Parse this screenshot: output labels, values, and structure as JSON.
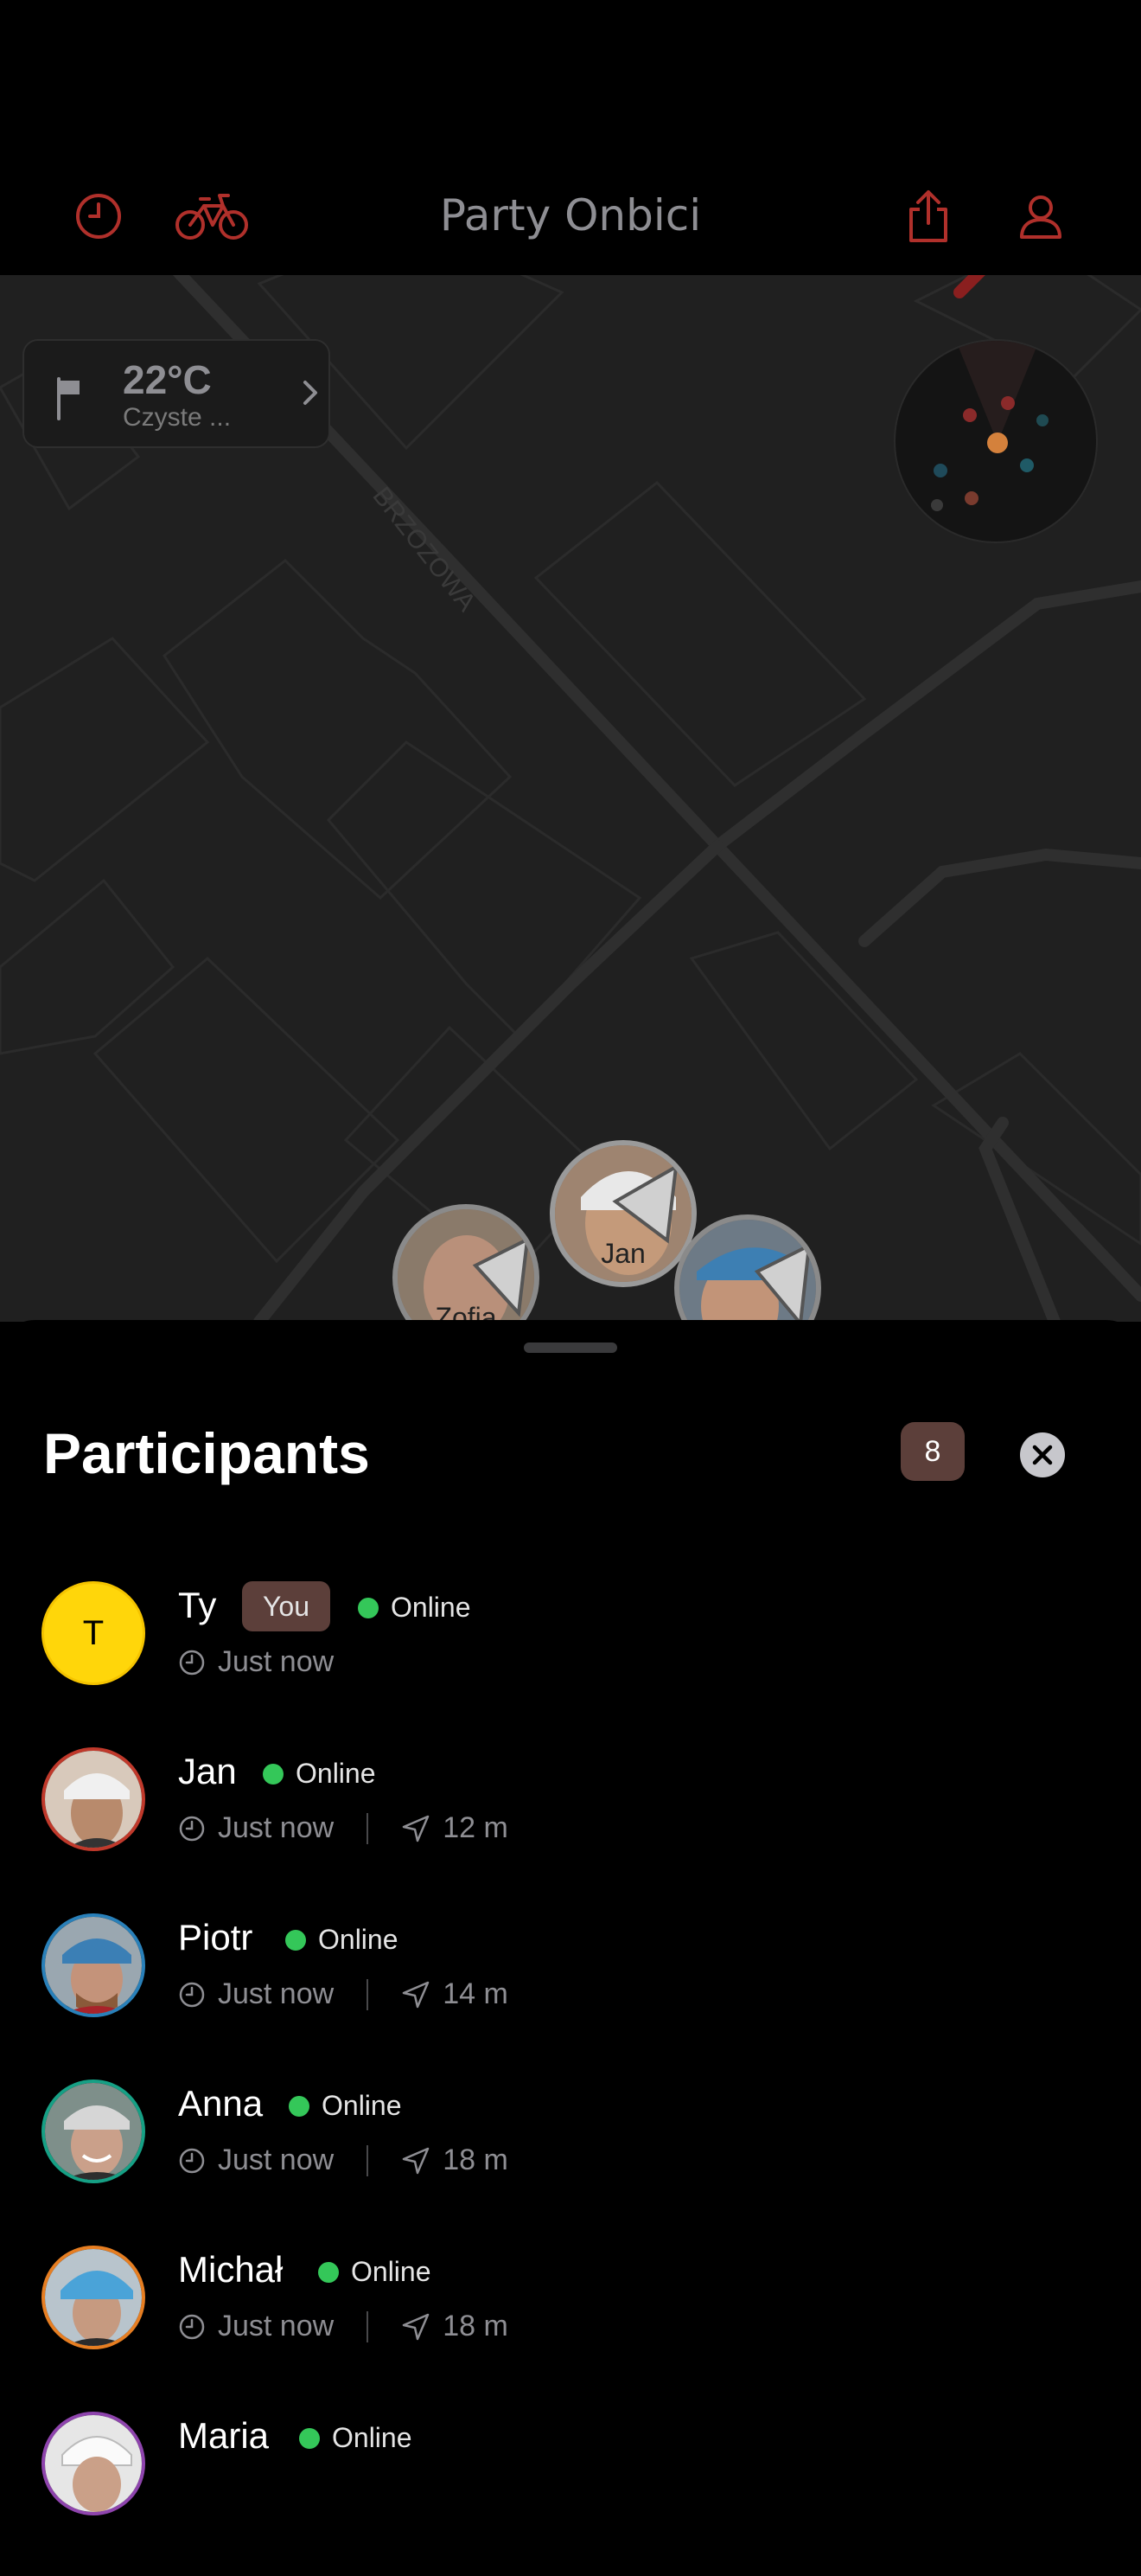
{
  "app": {
    "title": "Party Onbici"
  },
  "weather": {
    "temperature": "22°C",
    "description": "Czyste ..."
  },
  "map": {
    "street_label": "BRZOZOWA",
    "markers": [
      {
        "label": "Jan"
      },
      {
        "label": "Zofia"
      },
      {
        "label": ""
      }
    ]
  },
  "sheet": {
    "title": "Participants",
    "count": "8"
  },
  "participants": [
    {
      "name": "Ty",
      "badge": "You",
      "status": "Online",
      "time": "Just now",
      "distance": "",
      "avatar_initial": "T",
      "ring_color": "#f5c400",
      "avatar_color": "#ffd60a"
    },
    {
      "name": "Jan",
      "badge": "",
      "status": "Online",
      "time": "Just now",
      "distance": "12 m",
      "avatar_initial": "",
      "ring_color": "#c0392b",
      "avatar_color": "#b08a72"
    },
    {
      "name": "Piotr",
      "badge": "",
      "status": "Online",
      "time": "Just now",
      "distance": "14 m",
      "avatar_initial": "",
      "ring_color": "#2980b9",
      "avatar_color": "#6f8fa8"
    },
    {
      "name": "Anna",
      "badge": "",
      "status": "Online",
      "time": "Just now",
      "distance": "18 m",
      "avatar_initial": "",
      "ring_color": "#16a085",
      "avatar_color": "#7f9590"
    },
    {
      "name": "Michał",
      "badge": "",
      "status": "Online",
      "time": "Just now",
      "distance": "18 m",
      "avatar_initial": "",
      "ring_color": "#e67e22",
      "avatar_color": "#4f86b0"
    },
    {
      "name": "Maria",
      "badge": "",
      "status": "Online",
      "time": "",
      "distance": "",
      "avatar_initial": "",
      "ring_color": "#8e44ad",
      "avatar_color": "#d9d9d9"
    }
  ],
  "colors": {
    "accent": "#d0312d",
    "online": "#34c759",
    "badge_bg": "#5c3f3a"
  }
}
